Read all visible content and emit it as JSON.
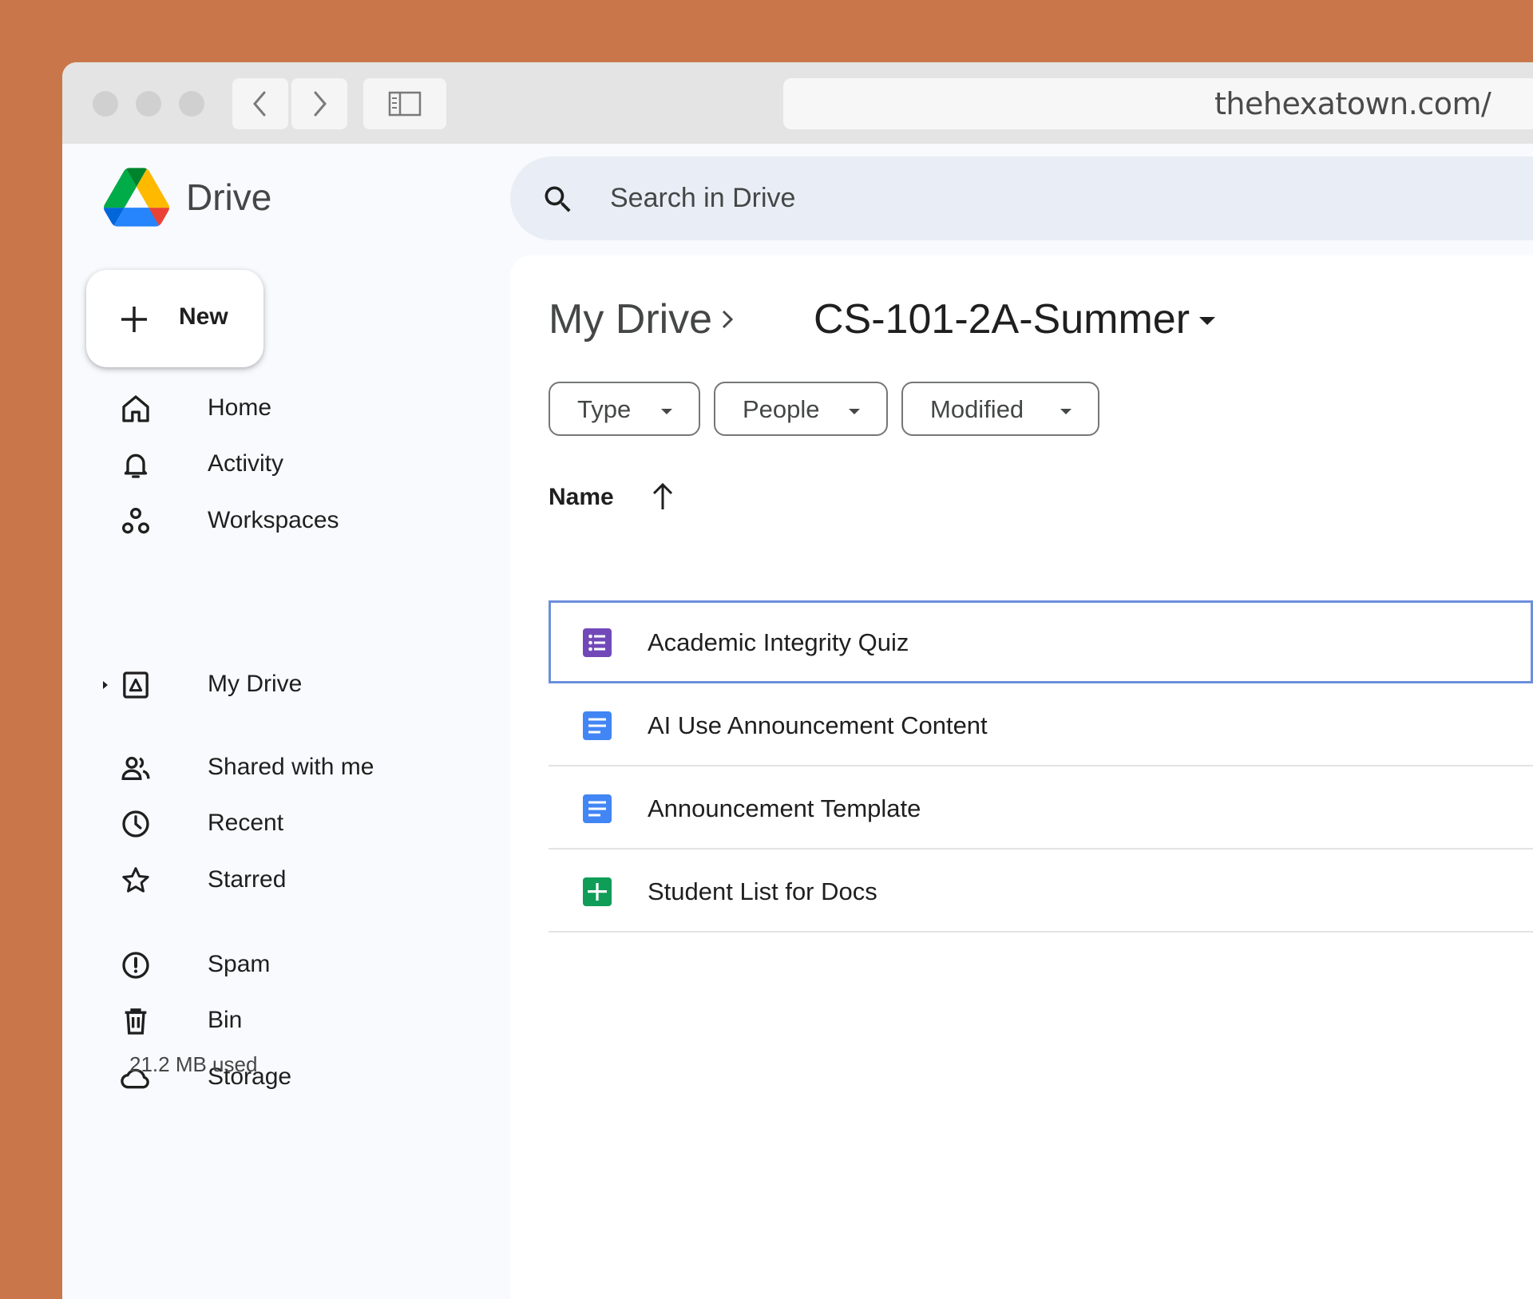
{
  "browser": {
    "url": "thehexatown.com/"
  },
  "app": {
    "name": "Drive",
    "search_placeholder": "Search in Drive",
    "new_label": "New"
  },
  "sidebar": {
    "items": [
      {
        "label": "Home",
        "icon": "home-icon"
      },
      {
        "label": "Activity",
        "icon": "bell-icon"
      },
      {
        "label": "Workspaces",
        "icon": "workspaces-icon"
      },
      {
        "label": "My Drive",
        "icon": "my-drive-icon"
      },
      {
        "label": "Shared with me",
        "icon": "people-icon"
      },
      {
        "label": "Recent",
        "icon": "clock-icon"
      },
      {
        "label": "Starred",
        "icon": "star-icon"
      },
      {
        "label": "Spam",
        "icon": "spam-icon"
      },
      {
        "label": "Bin",
        "icon": "trash-icon"
      },
      {
        "label": "Storage",
        "icon": "cloud-icon"
      }
    ],
    "storage_used": "21.2 MB used"
  },
  "breadcrumb": {
    "root": "My Drive",
    "current": "CS-101-2A-Summer"
  },
  "filters": [
    "Type",
    "People",
    "Modified"
  ],
  "table": {
    "column_name": "Name",
    "sort": "ascending",
    "files": [
      {
        "name": "Academic Integrity Quiz",
        "type": "forms",
        "selected": true
      },
      {
        "name": "AI Use Announcement Content",
        "type": "docs",
        "selected": false
      },
      {
        "name": "Announcement Template",
        "type": "docs",
        "selected": false
      },
      {
        "name": "Student List for Docs",
        "type": "sheets",
        "selected": false
      }
    ]
  },
  "colors": {
    "accent_blue": "#0b57d0",
    "selection_border": "#6c8fdc",
    "forms_purple": "#7248b9",
    "docs_blue": "#4285f4",
    "sheets_green": "#0f9d58"
  }
}
